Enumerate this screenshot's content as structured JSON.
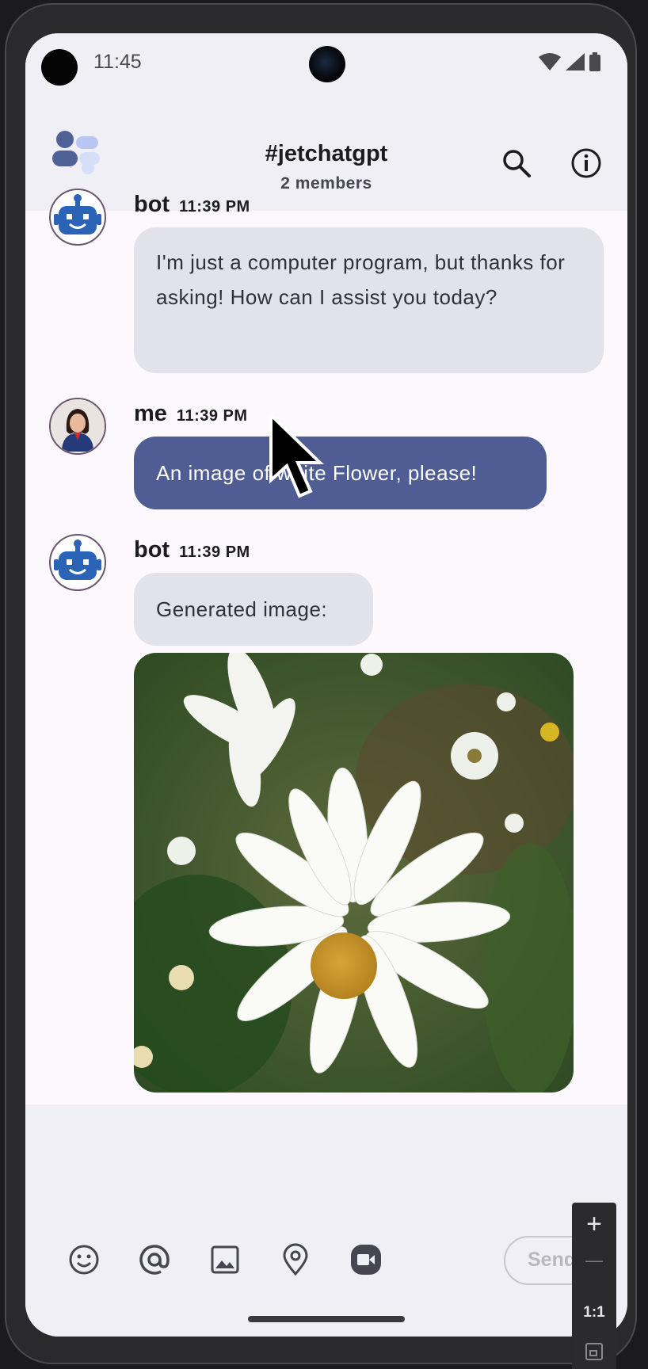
{
  "status_bar": {
    "time": "11:45"
  },
  "app_bar": {
    "title": "#jetchatgpt",
    "subtitle": "2 members",
    "logo_icon": "jetchat-logo-icon",
    "search_icon": "search-icon",
    "info_icon": "info-icon"
  },
  "messages": [
    {
      "author": "bot",
      "time": "11:39 PM",
      "text": "I'm just a computer program, but thanks for asking! How can I assist you today?"
    },
    {
      "author": "me",
      "time": "11:39 PM",
      "text": "An image of white Flower, please!"
    },
    {
      "author": "bot",
      "time": "11:39 PM",
      "text": "Generated image:",
      "has_image": true
    }
  ],
  "input_bar": {
    "tools": [
      "emoji-icon",
      "mention-icon",
      "image-icon",
      "location-icon",
      "video-icon"
    ],
    "send_label": "Send"
  },
  "zoom_panel": {
    "plus": "+",
    "minus": "—",
    "ratio": "1:1"
  },
  "colors": {
    "bot_bubble": "#e2e2ea",
    "me_bubble": "#4f5d94",
    "accent": "#3c5bab",
    "background": "#fcf8fd",
    "bar_background": "#f0eff5"
  }
}
